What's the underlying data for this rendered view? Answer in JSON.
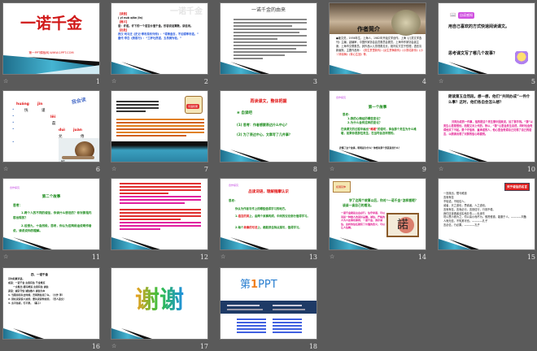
{
  "colors": {
    "background": "#5a5a5a",
    "swoosh": "#2a8fb0",
    "title_red": "#d01818"
  },
  "slides": [
    {
      "number": "1",
      "title": "一诺千金",
      "subtitle": "第一PPT模板网-WWW.1PPT.COM"
    },
    {
      "number": "2",
      "watermark": "一诺千金",
      "h1": "【读音】",
      "pinyin": "( yī nuò qiān jīn)",
      "h2": "【释义】",
      "meaning": "诺：许诺。许下的一个诺言价值千金。形容说话算数，讲信用。",
      "h3": "【出处】",
      "src1": "西汉·司马迁《史记·季布栾布列传》：“得黄金百，不如得季布诺。”",
      "src2": "唐代·李白《侠客行》：“三杯吐然诺，五岳倒为轻。”"
    },
    {
      "number": "3",
      "title": "一诺千金的由来"
    },
    {
      "number": "4",
      "title": "作者简介",
      "body": "●姜文范，1956年生，上海人，1982年开始文学创作。上海《儿童文学选刊》主编，副编审，中国作家协会会员委员会委员，上海市作家协会副主席，上海市文联委员。其作品以儿童视角见长，既朴实又富于哲理，语言清新幽默。主要作品有：",
      "works": "《男生贾里新传》《女生贾梅新传》《小香咕新传》《小丫林晓梅》《草心生回》等。"
    },
    {
      "number": "5",
      "badge": "自读感知",
      "q1": "用自己喜欢的方式快速阅读课文。",
      "q2": "思考课文写了哪几个故事？"
    },
    {
      "number": "6",
      "label": "我会读",
      "p1": "huáng",
      "p2": "jǐn",
      "c1": "恍",
      "c2": "谨",
      "p3": "lěi",
      "c3": "磊",
      "p4": "duì",
      "p5": "juàn",
      "c4": "兑",
      "c5": "倦",
      "caption": "蜗牛"
    },
    {
      "number": "7",
      "badge": "词语积累"
    },
    {
      "number": "8",
      "title": "再读课文，整体把握",
      "sub": "❀ 自读吧",
      "q1": "(1) 思考：作者想要表达什么中心？",
      "q2": "(2) 为了表达中心，文章写了几件事？"
    },
    {
      "number": "9",
      "badge": "合作探究",
      "title": "第一个故事",
      "think": "思考：",
      "q1": "1.我的心情经历哪些变化？",
      "q2": "2.为什么会有这样的变化？",
      "body_a": "在读课文的过程中画出",
      "hl": "“难堪”",
      "body_b": "的语句，体会那个男生为什么难堪，如果你是那位男生，在当时会怎样想的。",
      "foot": "弄懂了这个故事，明明是为什么？你想对那个男孩说些什么？"
    },
    {
      "number": "10",
      "q": "朗读第五自然段。想一想，他们“共同办成”一件什么事？这时，他们各自会怎么想？",
      "body": "共同办成的一件事，指的是这个男生替中国来说，加了那手钱。“我”以男生心里是很怕，而是又对上代的，所以，“我”心里会男生自然，同时也会觉得他买了不起。是个守信用、重承诺的人，他心里会觉得自己兑现了自己的诺言，以朗读出现了对那的信心和喜悦。"
    },
    {
      "number": "11",
      "badge": "合作探究",
      "title": "第二个故事",
      "think": "思考：",
      "q1": "1.两个人的不同的诚信，你读什么想法的？你对那是内容出现的？",
      "q2": "2.设想九，十自然段，思考，你认为这两段话说明作者说，请说说你的理解。"
    },
    {
      "number": "12"
    },
    {
      "number": "13",
      "badge": "合作探究",
      "title": "品读词语，理解揣摩认识",
      "think": "思考：",
      "q": "你认为作者写作上的哪些值得学习的地方。",
      "a1a": "1.",
      "a1h": "语言的美",
      "a1b": "上，由两个故事构成，中间的议论部分值得学习。",
      "a2a": "2.每个",
      "a2h": "故事的写法",
      "a2b": "上，都能抓住特点描写，值得学习。"
    },
    {
      "number": "14",
      "badge": "拓展延伸",
      "q": "学了这两个故事以后，你对“一诺千金”怎样看呢？谈谈一谈自己的看法。",
      "body": "一诺千金就是言出必行，信守承诺，可以说是一种做人的美好品德。诚信，严格的人为人处事有原则，一诺千金，谈存诚信，这样的信任就有了价值的含义，可以让人信赖。",
      "glyph": "諾"
    },
    {
      "number": "15",
      "title": "关于诚信的名言",
      "lines": [
        "一言既出，驷马难追",
        "言而有信",
        "不轻诺，不轻信人。",
        "诚者，天之道也；思诚者，人之道也。",
        "言而有信，言而必行。言则信行，行则不倦。",
        "我们应该做者谈实地办事——毛泽东",
        "勿以恶小而为之，勿以善小而不为。惟贤惟德，能服于人。————刘备",
        "人而无信，不知其可也。————孔子",
        "言必信，行必果。————孔子"
      ]
    },
    {
      "number": "16",
      "title": "四、一诺千金",
      "lines": [
        "诗句积累词语。",
        "成语：一诺千金  言而有信  千金难买",
        "一言既出 驷马难追  言而有信 诚信",
        "谚语：诚实守信 诚信做人 诚信为本",
        "1. 当我用尽失去时候，吾得到信用了么。（大作 泽）",
        "2. 别在说说说人这些，要先说说你这些。（圣人语文）",
        "3. 言不信者，行不果。（墨子）"
      ]
    },
    {
      "number": "17",
      "thanks": "谢谢"
    },
    {
      "number": "18",
      "logo_a": "第",
      "logo_b": "1",
      "logo_c": "PPT"
    }
  ]
}
